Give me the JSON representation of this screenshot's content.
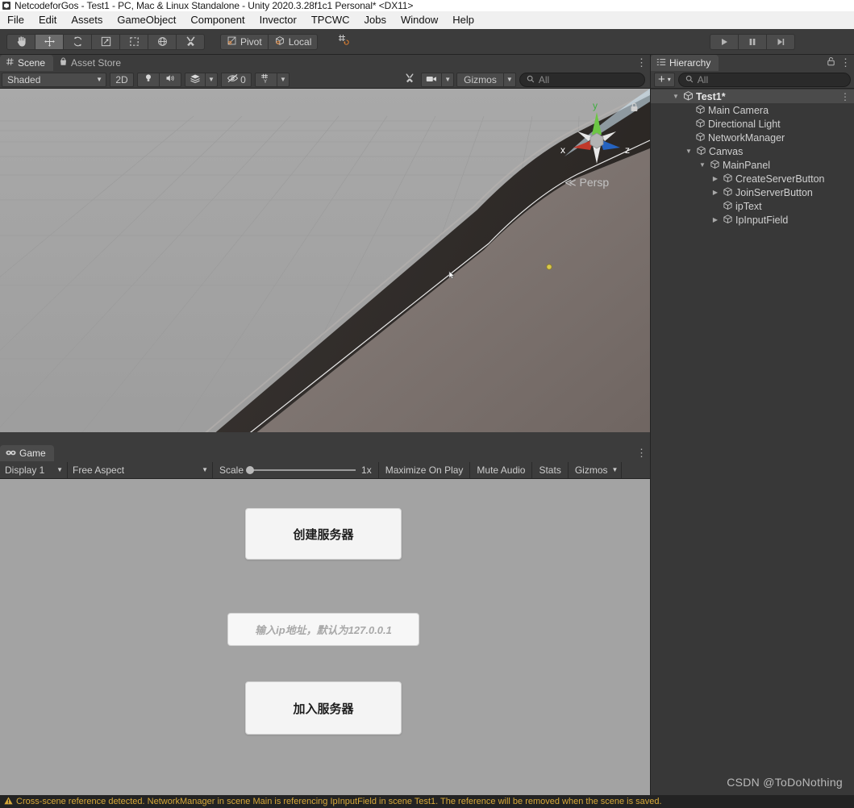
{
  "window": {
    "title": "NetcodeforGos - Test1 - PC, Mac & Linux Standalone - Unity 2020.3.28f1c1 Personal* <DX11>",
    "logo_icon": "unity-logo-icon"
  },
  "menubar": {
    "items": [
      {
        "label": "File"
      },
      {
        "label": "Edit"
      },
      {
        "label": "Assets"
      },
      {
        "label": "GameObject"
      },
      {
        "label": "Component"
      },
      {
        "label": "Invector"
      },
      {
        "label": "TPCWC"
      },
      {
        "label": "Jobs"
      },
      {
        "label": "Window"
      },
      {
        "label": "Help"
      }
    ]
  },
  "toolbar": {
    "tools": [
      {
        "name": "hand-tool",
        "icon": "hand-icon",
        "active": false
      },
      {
        "name": "move-tool",
        "icon": "move-arrows-icon",
        "active": true
      },
      {
        "name": "rotate-tool",
        "icon": "rotate-icon",
        "active": false
      },
      {
        "name": "scale-tool",
        "icon": "scale-icon",
        "active": false
      },
      {
        "name": "rect-tool",
        "icon": "rect-transform-icon",
        "active": false
      },
      {
        "name": "transform-tool",
        "icon": "transform-icon",
        "active": false
      },
      {
        "name": "custom-tool",
        "icon": "wrench-screwdriver-icon",
        "active": false
      }
    ],
    "pivot_label": "Pivot",
    "pivot_icon": "pivot-center-icon",
    "local_label": "Local",
    "local_icon": "local-cube-icon",
    "snap_icon": "grid-snap-icon",
    "play_label": "play-button",
    "pause_label": "pause-button",
    "step_label": "step-button"
  },
  "scene_panel": {
    "tabs": [
      {
        "label": "Scene",
        "icon": "scene-hash-icon",
        "active": true
      },
      {
        "label": "Asset Store",
        "icon": "asset-store-bag-icon",
        "active": false
      }
    ],
    "kebab": "⋮",
    "draw_mode": "Shaded",
    "toggle_2d": "2D",
    "lighting_icon": "lightbulb-icon",
    "audio_icon": "speaker-icon",
    "fx_icon": "effects-icon",
    "hidden_objects_label": "0",
    "hidden_objects_icon": "eye-off-icon",
    "grid_icon": "grid-y-icon",
    "tools_icon": "scene-tools-icon",
    "camera_icon": "scene-camera-icon",
    "gizmos_label": "Gizmos",
    "search_placeholder": "All",
    "search_icon": "search-icon",
    "persp_label": "Persp",
    "persp_prefix": "≪",
    "axis_x": "x",
    "axis_y": "y",
    "axis_z": "z",
    "lock_icon": "lock-icon"
  },
  "game_panel": {
    "tabs": [
      {
        "label": "Game",
        "icon": "game-controller-icon",
        "active": true
      }
    ],
    "kebab": "⋮",
    "display": "Display 1",
    "aspect": "Free Aspect",
    "scale_label": "Scale",
    "scale_value": "1x",
    "maximize_label": "Maximize On Play",
    "mute_label": "Mute Audio",
    "stats_label": "Stats",
    "gizmos_label": "Gizmos",
    "content": {
      "create_server_button": "创建服务器",
      "ip_input_placeholder": "输入ip地址，默认为127.0.0.1",
      "join_server_button": "加入服务器"
    },
    "watermark": "CSDN @ToDoNothing"
  },
  "hierarchy": {
    "tab_label": "Hierarchy",
    "tab_icon": "hierarchy-list-icon",
    "lock_icon": "lock-icon",
    "kebab": "⋮",
    "add_label": "+",
    "add_caret": "▾",
    "search_placeholder": "All",
    "search_icon": "search-icon",
    "items": [
      {
        "label": "Test1*",
        "depth": 0,
        "arrow": "down",
        "icon": "scene-icon",
        "selected": true,
        "kebab": "⋮"
      },
      {
        "label": "Main Camera",
        "depth": 2,
        "arrow": "none",
        "icon": "gameobject-cube-icon",
        "selected": false
      },
      {
        "label": "Directional Light",
        "depth": 2,
        "arrow": "none",
        "icon": "gameobject-cube-icon",
        "selected": false
      },
      {
        "label": "NetworkManager",
        "depth": 2,
        "arrow": "none",
        "icon": "gameobject-cube-icon",
        "selected": false
      },
      {
        "label": "Canvas",
        "depth": 1,
        "arrow": "down",
        "icon": "gameobject-cube-icon",
        "selected": false
      },
      {
        "label": "MainPanel",
        "depth": 2,
        "arrow": "down",
        "icon": "gameobject-cube-icon",
        "selected": false
      },
      {
        "label": "CreateServerButton",
        "depth": 3,
        "arrow": "right",
        "icon": "gameobject-cube-icon",
        "selected": false
      },
      {
        "label": "JoinServerButton",
        "depth": 3,
        "arrow": "right",
        "icon": "gameobject-cube-icon",
        "selected": false
      },
      {
        "label": "ipText",
        "depth": 4,
        "arrow": "none",
        "icon": "gameobject-cube-icon",
        "selected": false
      },
      {
        "label": "IpInputField",
        "depth": 3,
        "arrow": "right",
        "icon": "gameobject-cube-icon",
        "selected": false
      }
    ]
  },
  "statusbar": {
    "warning_icon": "warning-triangle-icon",
    "message": "Cross-scene reference detected. NetworkManager in scene Main is referencing IpInputField in scene Test1. The reference will be removed when the scene is saved."
  },
  "colors": {
    "accent_orange": "#e08030",
    "panel_bg": "#3c3c3c",
    "window_bg": "#383838",
    "warning": "#d8a93a"
  }
}
